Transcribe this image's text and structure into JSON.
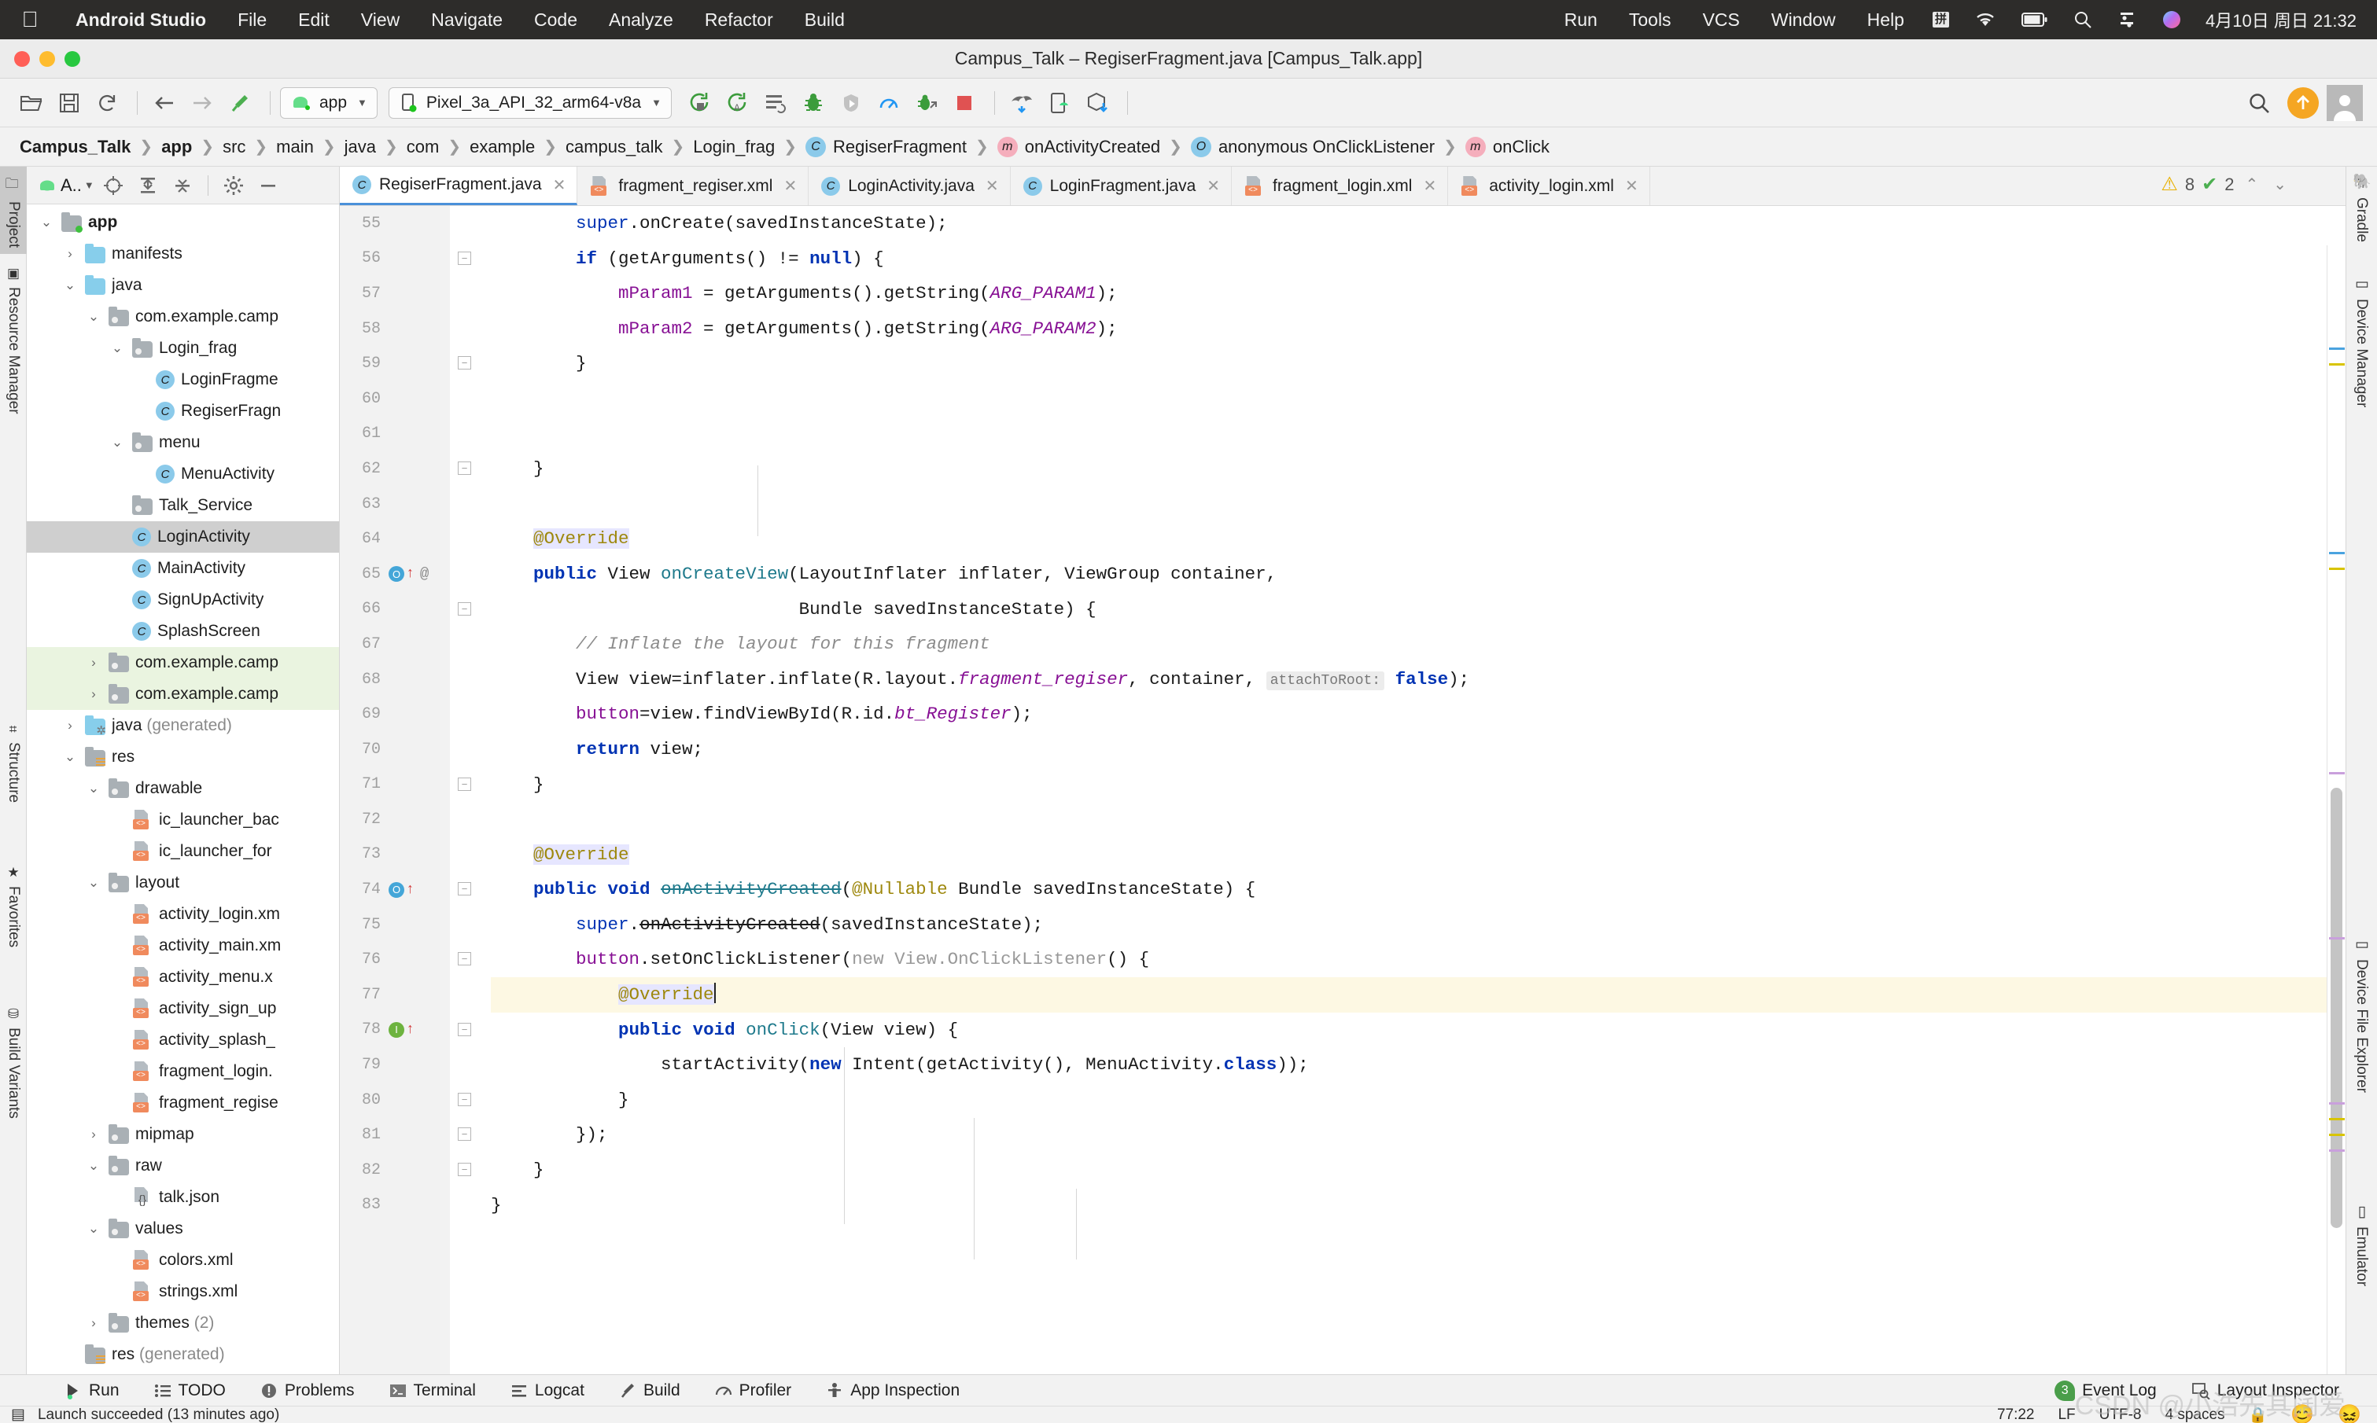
{
  "macos": {
    "apple_icon": "apple-icon",
    "app_name": "Android Studio",
    "menus": [
      "File",
      "Edit",
      "View",
      "Navigate",
      "Code",
      "Analyze",
      "Refactor",
      "Build"
    ],
    "right_menus": [
      "Run",
      "Tools",
      "VCS",
      "Window",
      "Help"
    ],
    "ime_label": "拼",
    "clock": "4月10日 周日 21:32"
  },
  "window": {
    "title": "Campus_Talk – RegiserFragment.java [Campus_Talk.app]"
  },
  "toolbar": {
    "module_selector": "app",
    "device_selector": "Pixel_3a_API_32_arm64-v8a",
    "icons": [
      "open-folder-icon",
      "save-icon",
      "sync-icon",
      "back-arrow-icon",
      "forward-arrow-icon",
      "build-hammer-icon"
    ],
    "run_icons": [
      "run-icon",
      "apply-changes-icon",
      "apply-code-changes-icon",
      "debug-icon",
      "attach-debugger-icon",
      "profiler-icon",
      "debug-attach-icon",
      "stop-icon"
    ],
    "right_icons": [
      "gradle-sync-icon",
      "avd-manager-icon",
      "sdk-manager-icon"
    ],
    "search_icon": "search-icon",
    "update_icon": "update-available-icon",
    "avatar": "user-avatar-icon"
  },
  "breadcrumb": [
    {
      "label": "Campus_Talk",
      "bold": true,
      "badge": null
    },
    {
      "label": "app",
      "bold": true,
      "badge": null
    },
    {
      "label": "src",
      "bold": false,
      "badge": null
    },
    {
      "label": "main",
      "bold": false,
      "badge": null
    },
    {
      "label": "java",
      "bold": false,
      "badge": null
    },
    {
      "label": "com",
      "bold": false,
      "badge": null
    },
    {
      "label": "example",
      "bold": false,
      "badge": null
    },
    {
      "label": "campus_talk",
      "bold": false,
      "badge": null
    },
    {
      "label": "Login_frag",
      "bold": false,
      "badge": null
    },
    {
      "label": "RegiserFragment",
      "bold": false,
      "badge": "C"
    },
    {
      "label": "onActivityCreated",
      "bold": false,
      "badge": "m"
    },
    {
      "label": "anonymous OnClickListener",
      "bold": false,
      "badge": "O"
    },
    {
      "label": "onClick",
      "bold": false,
      "badge": "m"
    }
  ],
  "left_tool_strip": [
    {
      "label": "Project",
      "icon": "project-icon",
      "selected": true
    },
    {
      "label": "Resource Manager",
      "icon": "resource-manager-icon",
      "selected": false
    },
    {
      "label": "Structure",
      "icon": "structure-icon",
      "selected": false
    },
    {
      "label": "Favorites",
      "icon": "star-icon",
      "selected": false
    },
    {
      "label": "Build Variants",
      "icon": "build-variants-icon",
      "selected": false
    }
  ],
  "right_tool_strip": [
    {
      "label": "Gradle",
      "icon": "gradle-elephant-icon"
    },
    {
      "label": "Device Manager",
      "icon": "device-manager-icon"
    },
    {
      "label": "Device File Explorer",
      "icon": "device-file-explorer-icon"
    },
    {
      "label": "Emulator",
      "icon": "emulator-icon"
    }
  ],
  "project_panel": {
    "title": "A..",
    "toolbar_icons": [
      "android-icon",
      "locate-icon",
      "expand-all-icon",
      "collapse-all-icon",
      "settings-gear-icon",
      "hide-icon"
    ],
    "tree": [
      {
        "label": "app",
        "indent": 0,
        "arrow": "down",
        "icon": "module-icon",
        "bold": true,
        "state": "normal"
      },
      {
        "label": "manifests",
        "indent": 1,
        "arrow": "right",
        "icon": "folder-blue",
        "bold": false,
        "state": "normal"
      },
      {
        "label": "java",
        "indent": 1,
        "arrow": "down",
        "icon": "folder-blue",
        "bold": false,
        "state": "normal"
      },
      {
        "label": "com.example.camp",
        "indent": 2,
        "arrow": "down",
        "icon": "folder-gray",
        "bold": false,
        "state": "normal"
      },
      {
        "label": "Login_frag",
        "indent": 3,
        "arrow": "down",
        "icon": "folder-gray",
        "bold": false,
        "state": "normal"
      },
      {
        "label": "LoginFragme",
        "indent": 4,
        "arrow": "none",
        "icon": "class",
        "bold": false,
        "state": "normal"
      },
      {
        "label": "RegiserFragn",
        "indent": 4,
        "arrow": "none",
        "icon": "class",
        "bold": false,
        "state": "normal"
      },
      {
        "label": "menu",
        "indent": 3,
        "arrow": "down",
        "icon": "folder-gray",
        "bold": false,
        "state": "normal"
      },
      {
        "label": "MenuActivity",
        "indent": 4,
        "arrow": "none",
        "icon": "class",
        "bold": false,
        "state": "normal"
      },
      {
        "label": "Talk_Service",
        "indent": 3,
        "arrow": "none",
        "icon": "folder-gray",
        "bold": false,
        "state": "normal"
      },
      {
        "label": "LoginActivity",
        "indent": 3,
        "arrow": "none",
        "icon": "class",
        "bold": false,
        "state": "selected"
      },
      {
        "label": "MainActivity",
        "indent": 3,
        "arrow": "none",
        "icon": "class",
        "bold": false,
        "state": "normal"
      },
      {
        "label": "SignUpActivity",
        "indent": 3,
        "arrow": "none",
        "icon": "class",
        "bold": false,
        "state": "normal"
      },
      {
        "label": "SplashScreen",
        "indent": 3,
        "arrow": "none",
        "icon": "class",
        "bold": false,
        "state": "normal"
      },
      {
        "label": "com.example.camp",
        "indent": 2,
        "arrow": "right",
        "icon": "folder-gray",
        "bold": false,
        "state": "green"
      },
      {
        "label": "com.example.camp",
        "indent": 2,
        "arrow": "right",
        "icon": "folder-gray",
        "bold": false,
        "state": "green"
      },
      {
        "label": "java (generated)",
        "indent": 1,
        "arrow": "right",
        "icon": "generated",
        "bold": false,
        "state": "normal",
        "muted_from": 5
      },
      {
        "label": "res",
        "indent": 1,
        "arrow": "down",
        "icon": "res-dir",
        "bold": false,
        "state": "normal"
      },
      {
        "label": "drawable",
        "indent": 2,
        "arrow": "down",
        "icon": "folder-gray",
        "bold": false,
        "state": "normal"
      },
      {
        "label": "ic_launcher_bac",
        "indent": 3,
        "arrow": "none",
        "icon": "xml",
        "bold": false,
        "state": "normal"
      },
      {
        "label": "ic_launcher_for",
        "indent": 3,
        "arrow": "none",
        "icon": "xml",
        "bold": false,
        "state": "normal"
      },
      {
        "label": "layout",
        "indent": 2,
        "arrow": "down",
        "icon": "folder-gray",
        "bold": false,
        "state": "normal"
      },
      {
        "label": "activity_login.xm",
        "indent": 3,
        "arrow": "none",
        "icon": "xml",
        "bold": false,
        "state": "normal"
      },
      {
        "label": "activity_main.xm",
        "indent": 3,
        "arrow": "none",
        "icon": "xml",
        "bold": false,
        "state": "normal"
      },
      {
        "label": "activity_menu.x",
        "indent": 3,
        "arrow": "none",
        "icon": "xml",
        "bold": false,
        "state": "normal"
      },
      {
        "label": "activity_sign_up",
        "indent": 3,
        "arrow": "none",
        "icon": "xml",
        "bold": false,
        "state": "normal"
      },
      {
        "label": "activity_splash_",
        "indent": 3,
        "arrow": "none",
        "icon": "xml",
        "bold": false,
        "state": "normal"
      },
      {
        "label": "fragment_login.",
        "indent": 3,
        "arrow": "none",
        "icon": "xml",
        "bold": false,
        "state": "normal"
      },
      {
        "label": "fragment_regise",
        "indent": 3,
        "arrow": "none",
        "icon": "xml",
        "bold": false,
        "state": "normal"
      },
      {
        "label": "mipmap",
        "indent": 2,
        "arrow": "right",
        "icon": "folder-gray",
        "bold": false,
        "state": "normal"
      },
      {
        "label": "raw",
        "indent": 2,
        "arrow": "down",
        "icon": "folder-gray",
        "bold": false,
        "state": "normal"
      },
      {
        "label": "talk.json",
        "indent": 3,
        "arrow": "none",
        "icon": "json",
        "bold": false,
        "state": "normal"
      },
      {
        "label": "values",
        "indent": 2,
        "arrow": "down",
        "icon": "folder-gray",
        "bold": false,
        "state": "normal"
      },
      {
        "label": "colors.xml",
        "indent": 3,
        "arrow": "none",
        "icon": "xml",
        "bold": false,
        "state": "normal"
      },
      {
        "label": "strings.xml",
        "indent": 3,
        "arrow": "none",
        "icon": "xml",
        "bold": false,
        "state": "normal"
      },
      {
        "label": "themes (2)",
        "indent": 2,
        "arrow": "right",
        "icon": "folder-gray",
        "bold": false,
        "state": "normal",
        "muted_from": 7
      },
      {
        "label": "res (generated)",
        "indent": 1,
        "arrow": "none",
        "icon": "res-dir",
        "bold": false,
        "state": "normal",
        "muted_from": 4
      }
    ]
  },
  "editor": {
    "tabs": [
      {
        "label": "RegiserFragment.java",
        "icon": "java-class-icon",
        "active": true
      },
      {
        "label": "fragment_regiser.xml",
        "icon": "xml-file-icon",
        "active": false
      },
      {
        "label": "LoginActivity.java",
        "icon": "java-class-icon",
        "active": false
      },
      {
        "label": "LoginFragment.java",
        "icon": "java-class-icon",
        "active": false
      },
      {
        "label": "fragment_login.xml",
        "icon": "xml-file-icon",
        "active": false
      },
      {
        "label": "activity_login.xml",
        "icon": "xml-file-icon",
        "active": false
      }
    ],
    "inspection": {
      "warning_count": "8",
      "ok_count": "2",
      "warning_icon": "warning-triangle-icon",
      "ok_icon": "green-check-icon",
      "prev_icon": "chevron-up-icon",
      "next_icon": "chevron-down-icon"
    },
    "first_line_number": 55,
    "lines": [
      {
        "n": 55,
        "html": "        <span class=\"kwp\">super</span>.onCreate(savedInstanceState);"
      },
      {
        "n": 56,
        "html": "        <span class=\"kw\">if</span> (getArguments() != <span class=\"kw\">null</span>) {",
        "fold": true
      },
      {
        "n": 57,
        "html": "            <span class=\"field\">mParam1</span> = getArguments().getString(<span class=\"fieldi\">ARG_PARAM1</span>);"
      },
      {
        "n": 58,
        "html": "            <span class=\"field\">mParam2</span> = getArguments().getString(<span class=\"fieldi\">ARG_PARAM2</span>);"
      },
      {
        "n": 59,
        "html": "        }",
        "fold": true
      },
      {
        "n": 60,
        "html": ""
      },
      {
        "n": 61,
        "html": ""
      },
      {
        "n": 62,
        "html": "    }",
        "fold": true
      },
      {
        "n": 63,
        "html": ""
      },
      {
        "n": 64,
        "html": "    <span class=\"anno anno-bg\">@Override</span>"
      },
      {
        "n": 65,
        "html": "    <span class=\"kw\">public</span> View <span class=\"fn\">onCreateView</span>(LayoutInflater inflater, ViewGroup container,",
        "mark": "o",
        "at": true
      },
      {
        "n": 66,
        "html": "                             Bundle savedInstanceState) {",
        "fold": true
      },
      {
        "n": 67,
        "html": "        <span class=\"cmt\">// Inflate the layout for this fragment</span>"
      },
      {
        "n": 68,
        "html": "        View view=inflater.inflate(R.layout.<span class=\"fieldi\">fragment_regiser</span>, container, <span class=\"hint\">attachToRoot:</span> <span class=\"kw\">false</span>);"
      },
      {
        "n": 69,
        "html": "        <span class=\"field\">button</span>=view.findViewById(R.id.<span class=\"fieldi\">bt_Register</span>);"
      },
      {
        "n": 70,
        "html": "        <span class=\"kw\">return</span> view;"
      },
      {
        "n": 71,
        "html": "    }",
        "fold": true
      },
      {
        "n": 72,
        "html": ""
      },
      {
        "n": 73,
        "html": "    <span class=\"anno anno-bg\">@Override</span>"
      },
      {
        "n": 74,
        "html": "    <span class=\"kw\">public</span> <span class=\"kw\">void</span> <span class=\"fn strike\">onActivityCreated</span>(<span class=\"anno\">@Nullable</span> Bundle savedInstanceState) {",
        "mark": "o",
        "fold": true
      },
      {
        "n": 75,
        "html": "        <span class=\"kwp\">super</span>.<span class=\"strike\">onActivityCreated</span>(savedInstanceState);"
      },
      {
        "n": 76,
        "html": "        <span class=\"field\">button</span>.setOnClickListener(<span class=\"gray\">new View.OnClickListener</span>() {",
        "fold": true
      },
      {
        "n": 77,
        "html": "            <span class=\"anno anno-bg\">@Override</span><span class=\"caret-bar\"></span>",
        "highlight": true
      },
      {
        "n": 78,
        "html": "            <span class=\"kw\">public</span> <span class=\"kw\">void</span> <span class=\"fn\">onClick</span>(View view) {",
        "mark": "i",
        "fold": true
      },
      {
        "n": 79,
        "html": "                startActivity(<span class=\"kw\">new</span> Intent(getActivity(), MenuActivity.<span class=\"kw\">class</span>));"
      },
      {
        "n": 80,
        "html": "            }",
        "fold": true
      },
      {
        "n": 81,
        "html": "        });",
        "fold": true
      },
      {
        "n": 82,
        "html": "    }",
        "fold": true
      },
      {
        "n": 83,
        "html": "}"
      }
    ]
  },
  "bottom_bar": {
    "items": [
      {
        "label": "Run",
        "icon": "run-play-icon"
      },
      {
        "label": "TODO",
        "icon": "todo-list-icon"
      },
      {
        "label": "Problems",
        "icon": "problems-icon"
      },
      {
        "label": "Terminal",
        "icon": "terminal-icon"
      },
      {
        "label": "Logcat",
        "icon": "logcat-icon"
      },
      {
        "label": "Build",
        "icon": "build-hammer-icon"
      },
      {
        "label": "Profiler",
        "icon": "profiler-gauge-icon"
      },
      {
        "label": "App Inspection",
        "icon": "app-inspection-icon"
      }
    ],
    "right_items": [
      {
        "label": "Event Log",
        "icon": "event-log-icon",
        "badge": "3"
      },
      {
        "label": "Layout Inspector",
        "icon": "layout-inspector-icon",
        "badge": null
      }
    ]
  },
  "status_bar": {
    "message": "Launch succeeded (13 minutes ago)",
    "caret_position": "77:22",
    "line_separator": "LF",
    "encoding": "UTF-8",
    "indent": "4 spaces",
    "lock_icon": "lock-icon",
    "left_icon": "status-doc-icon"
  },
  "watermark": "CSDN @小浩先其阔爱"
}
